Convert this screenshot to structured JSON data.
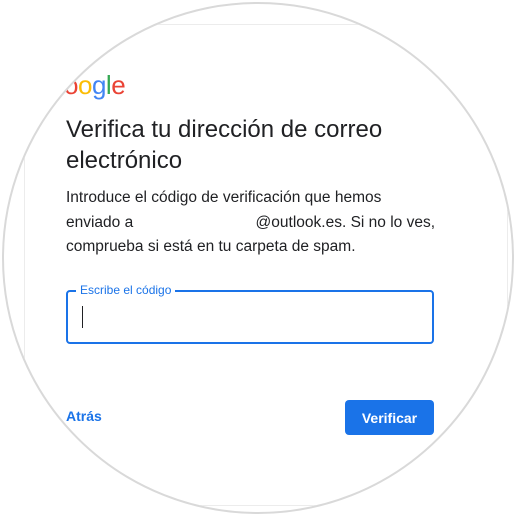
{
  "logo": {
    "text": "oogle",
    "letters": [
      {
        "ch": "o",
        "color": "#ea4335"
      },
      {
        "ch": "o",
        "color": "#fbbc05"
      },
      {
        "ch": "g",
        "color": "#4285f4"
      },
      {
        "ch": "l",
        "color": "#34a853"
      },
      {
        "ch": "e",
        "color": "#ea4335"
      }
    ]
  },
  "title": "Verifica tu dirección de correo electrónico",
  "description": {
    "part1": "Introduce el código de verificación que hemos enviado a",
    "email_suffix": "@outlook.es.",
    "part2": "Si no lo ves, comprueba si está en tu carpeta de spam."
  },
  "code_field": {
    "label": "Escribe el código",
    "value": ""
  },
  "actions": {
    "back_label": "Atrás",
    "verify_label": "Verificar"
  },
  "colors": {
    "accent": "#1a73e8",
    "text": "#202124"
  }
}
